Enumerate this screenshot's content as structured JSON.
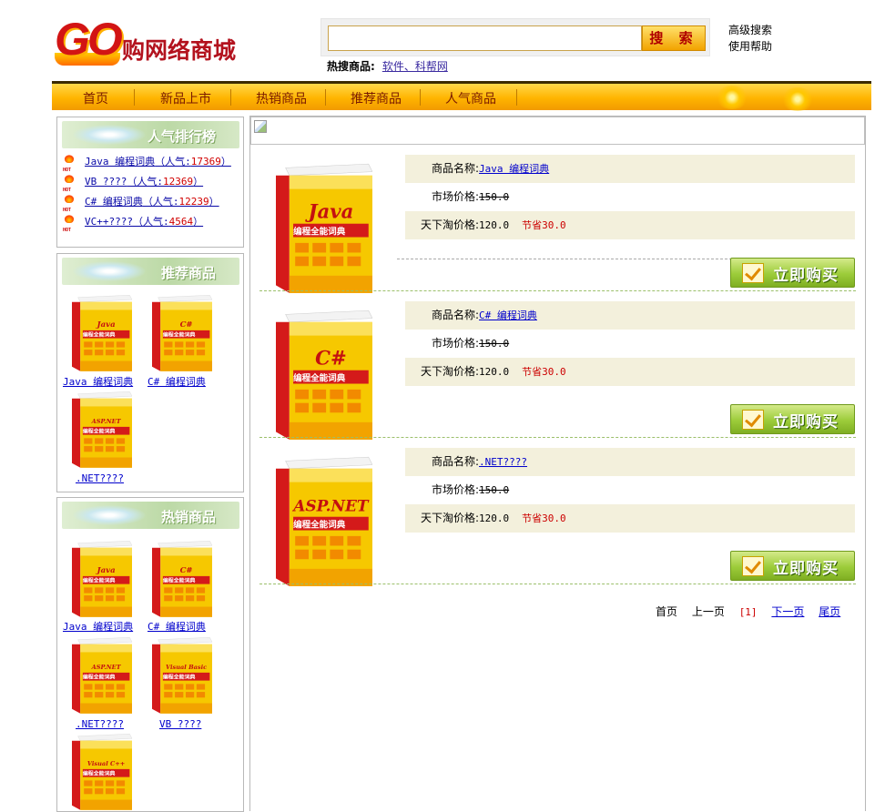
{
  "brand": {
    "logo_go": "GO",
    "logo_name": "购网络商城"
  },
  "search": {
    "button_label": "搜 索",
    "placeholder": "",
    "value": "",
    "hot_label": "热搜商品:",
    "hot_links": "软件、科帮网",
    "advanced": "高级搜索",
    "help": "使用帮助"
  },
  "nav": {
    "items": [
      "首页",
      "新品上市",
      "热销商品",
      "推荐商品",
      "人气商品"
    ]
  },
  "rank_panel": {
    "title": "人气排行榜",
    "badge": "HOT",
    "items": [
      {
        "name": "Java 编程词典",
        "prefix": "（人气:",
        "pop": "17369",
        "suffix": "）"
      },
      {
        "name": "VB ????",
        "prefix": "（人气:",
        "pop": "12369",
        "suffix": "）"
      },
      {
        "name": "C# 编程词典",
        "prefix": "（人气:",
        "pop": "12239",
        "suffix": "）"
      },
      {
        "name": "VC++????",
        "prefix": "（人气:",
        "pop": "4564",
        "suffix": "）"
      }
    ]
  },
  "recommend_panel": {
    "title": "推荐商品",
    "items": [
      {
        "name": "Java 编程词典",
        "cover": "Java"
      },
      {
        "name": "C# 编程词典",
        "cover": "C#"
      },
      {
        "name": ".NET????",
        "cover": "ASP.NET"
      }
    ]
  },
  "hot_panel": {
    "title": "热销商品",
    "items": [
      {
        "name": "Java 编程词典",
        "cover": "Java"
      },
      {
        "name": "C# 编程词典",
        "cover": "C#"
      },
      {
        "name": ".NET????",
        "cover": "ASP.NET"
      },
      {
        "name": "VB ????",
        "cover": "Visual Basic"
      },
      {
        "name": "",
        "cover": "Visual C++"
      }
    ]
  },
  "book_subtitle": "编程全能词典",
  "products": [
    {
      "name_label": "商品名称:",
      "name": "Java 编程词典",
      "cover": "Java",
      "market_label": "市场价格:",
      "market": "150.0",
      "price_label": "天下淘价格:",
      "price": "120.0",
      "save": "节省30.0",
      "buy": "立即购买"
    },
    {
      "name_label": "商品名称:",
      "name": "C# 编程词典",
      "cover": "C#",
      "market_label": "市场价格:",
      "market": "150.0",
      "price_label": "天下淘价格:",
      "price": "120.0",
      "save": "节省30.0",
      "buy": "立即购买"
    },
    {
      "name_label": "商品名称:",
      "name": ".NET????",
      "cover": "ASP.NET",
      "market_label": "市场价格:",
      "market": "150.0",
      "price_label": "天下淘价格:",
      "price": "120.0",
      "save": "节省30.0",
      "buy": "立即购买"
    }
  ],
  "pager": {
    "first": "首页",
    "prev": "上一页",
    "current": "[1]",
    "next": "下一页",
    "last": "尾页"
  },
  "colors": {
    "nav_gold": "#ffb400",
    "accent_red": "#cc0000",
    "link_blue": "#0000cc",
    "panel_green": "#bcd9a6",
    "row_shade": "#f3f0dc"
  }
}
